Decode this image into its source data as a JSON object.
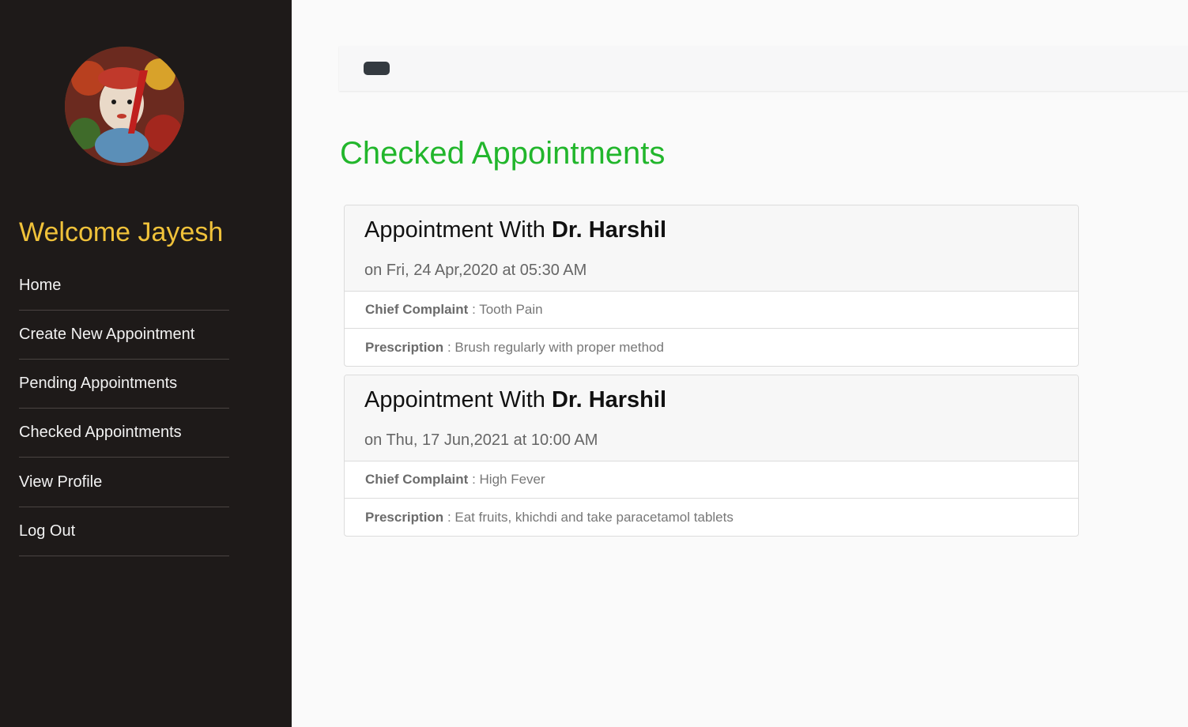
{
  "sidebar": {
    "welcome": "Welcome Jayesh",
    "nav": [
      {
        "label": "Home"
      },
      {
        "label": "Create New Appointment"
      },
      {
        "label": "Pending Appointments"
      },
      {
        "label": "Checked Appointments"
      },
      {
        "label": "View Profile"
      },
      {
        "label": "Log Out"
      }
    ]
  },
  "main": {
    "title": "Checked Appointments",
    "appointments": [
      {
        "title_prefix": "Appointment With",
        "doctor": "Dr. Harshil",
        "date": "on Fri, 24 Apr,2020 at 05:30 AM",
        "complaint_label": "Chief Complaint",
        "complaint_value": ": Tooth Pain",
        "prescription_label": "Prescription",
        "prescription_value": ": Brush regularly with proper method"
      },
      {
        "title_prefix": "Appointment With",
        "doctor": "Dr. Harshil",
        "date": "on Thu, 17 Jun,2021 at 10:00 AM",
        "complaint_label": "Chief Complaint",
        "complaint_value": ": High Fever",
        "prescription_label": "Prescription",
        "prescription_value": ": Eat fruits, khichdi and take paracetamol tablets"
      }
    ]
  },
  "colors": {
    "sidebar_bg": "#1e1a19",
    "welcome": "#f0c23a",
    "title": "#22b62c",
    "toggle": "#343a40"
  },
  "icons": {
    "avatar": "profile-avatar",
    "toggle": "sidebar-toggle-icon"
  }
}
